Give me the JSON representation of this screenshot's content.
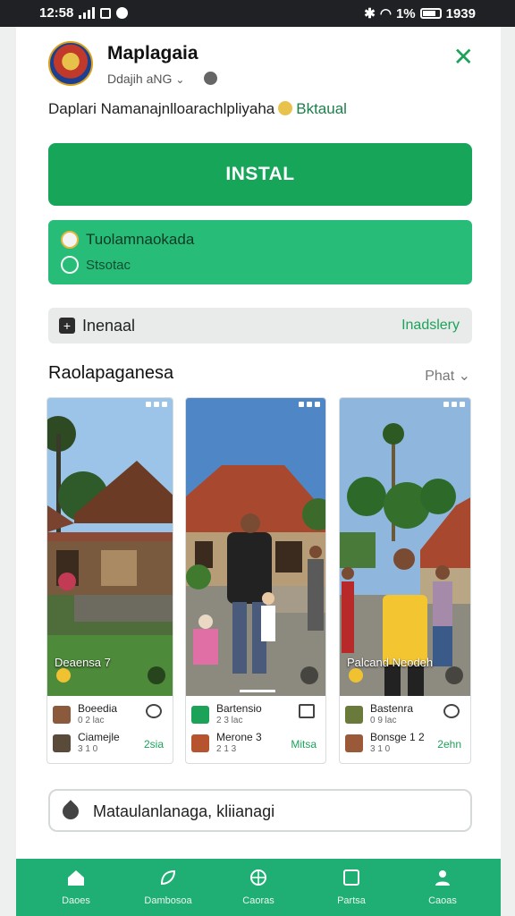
{
  "status_bar": {
    "time": "12:58",
    "battery": "1%",
    "extra": "1939"
  },
  "app": {
    "name": "Maplagaia",
    "developer": "Ddajih aNG",
    "description_main": "Daplari Namanajnlloarachlpliyaha",
    "description_accent": "Bktaual"
  },
  "install_label": "INSTAL",
  "green_card": {
    "line1": "Tuolamnaokada",
    "line2": "Stsotac"
  },
  "grey_bar": {
    "label": "Inenaal",
    "right": "Inadslery"
  },
  "section": {
    "title": "Raolapaganesa",
    "filter": "Phat"
  },
  "screenshots": [
    {
      "caption": "Deaensa 7",
      "row1_title": "Boeedia",
      "row1_sub": "0 2 lac",
      "row2_title": "Ciamejle",
      "row2_sub": "3 1 0",
      "row2_right": "2sia"
    },
    {
      "caption": "",
      "row1_title": "Bartensio",
      "row1_sub": "2 3 lac",
      "row2_title": "Merone 3",
      "row2_sub": "2 1 3",
      "row2_right": "Mitsa"
    },
    {
      "caption": "Palcand Neodeh",
      "row1_title": "Bastenra",
      "row1_sub": "0 9 lac",
      "row2_title": "Bonsge 1 2",
      "row2_sub": "3 1 0",
      "row2_right": "2ehn"
    }
  ],
  "comment_placeholder": "Mataulanlanaga, kliianagi",
  "nav": [
    {
      "label": "Daoes"
    },
    {
      "label": "Dambosoa"
    },
    {
      "label": "Caoras"
    },
    {
      "label": "Partsa"
    },
    {
      "label": "Caoas"
    }
  ],
  "colors": {
    "accent": "#17a55a",
    "card": "#27bd79",
    "nav": "#1fae73"
  }
}
